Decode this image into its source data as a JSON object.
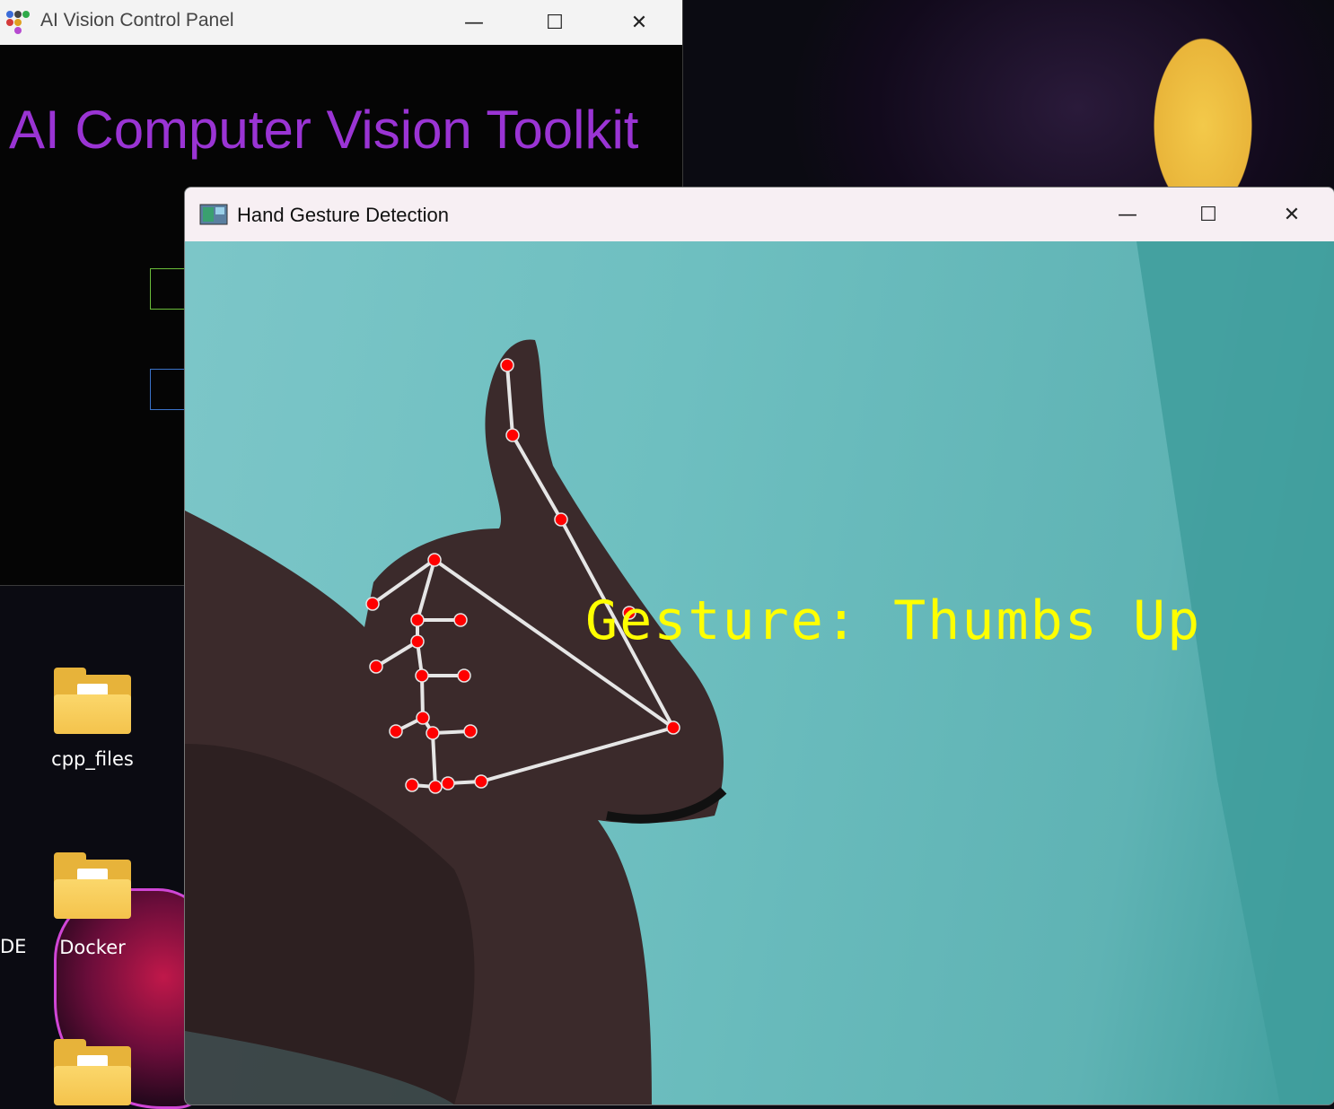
{
  "desktop": {
    "icons": [
      {
        "label": "cpp_files",
        "icon": "folder-icon"
      },
      {
        "label": "Docker",
        "icon": "folder-icon"
      },
      {
        "label": "",
        "icon": "folder-icon"
      }
    ],
    "partial_label": "DE"
  },
  "control_panel": {
    "title": "AI Vision Control Panel",
    "heading": "AI Computer Vision Toolkit",
    "heading_color": "#9a34d4",
    "app_icon": "colored-dots-icon"
  },
  "gesture_window": {
    "title": "Hand Gesture Detection",
    "app_icon": "image-viewer-icon",
    "overlay_text": "Gesture: Thumbs Up",
    "overlay_color": "#ffff00",
    "landmark_color": "#ff0000",
    "skeleton_color": "#e6e6e6"
  },
  "window_controls": {
    "minimize": "—",
    "maximize": "☐",
    "close": "✕"
  }
}
